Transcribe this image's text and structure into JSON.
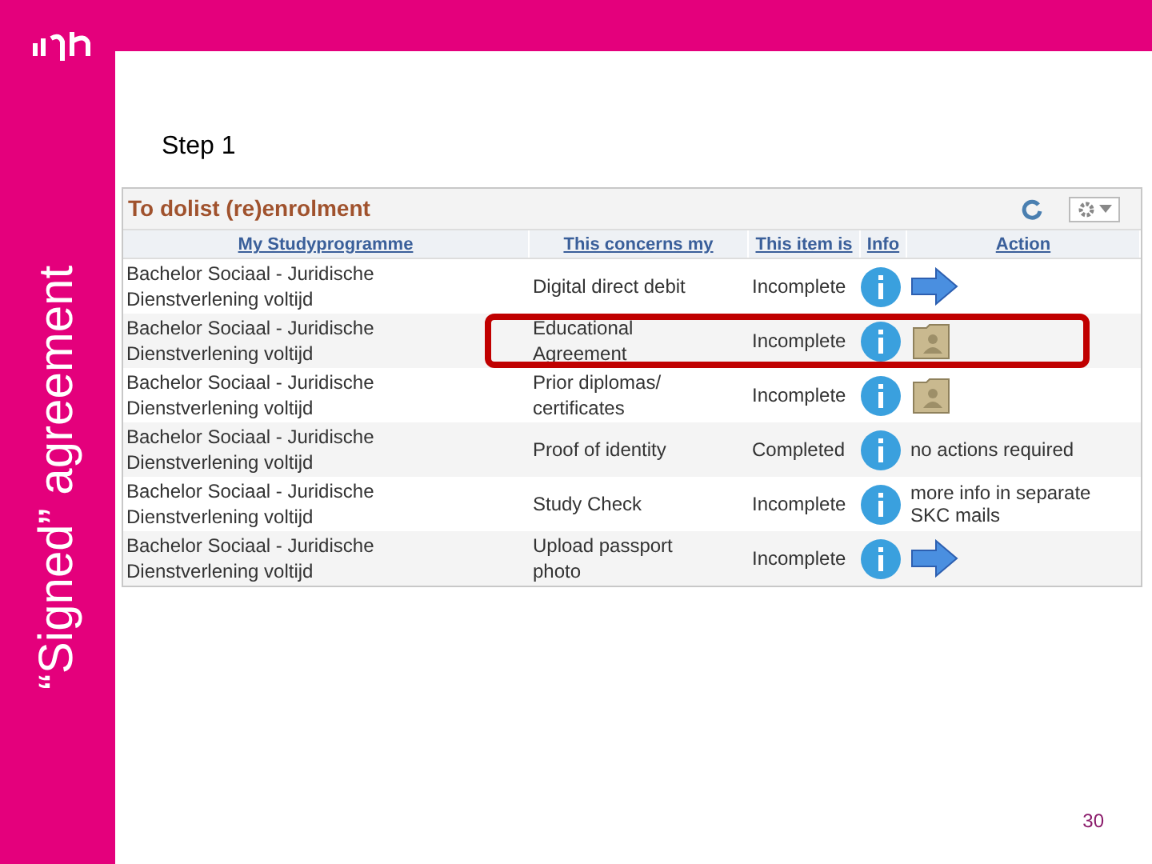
{
  "slide": {
    "side_title": "“Signed” agreement",
    "step": "Step 1",
    "page_number": "30"
  },
  "panel": {
    "title": "To dolist (re)enrolment",
    "columns": [
      "My Studyprogramme",
      "This concerns my",
      "This item is",
      "Info",
      "Action"
    ],
    "rows": [
      {
        "programme": [
          "Bachelor Sociaal - Juridische",
          "Dienstverlening voltijd"
        ],
        "concerns": "Digital direct debit",
        "status": "Incomplete",
        "action": {
          "kind": "arrow"
        },
        "highlighted": false
      },
      {
        "programme": [
          "Bachelor Sociaal - Juridische",
          "Dienstverlening voltijd"
        ],
        "concerns": "Educational Agreement",
        "status": "Incomplete",
        "action": {
          "kind": "folder"
        },
        "highlighted": true
      },
      {
        "programme": [
          "Bachelor Sociaal - Juridische",
          "Dienstverlening voltijd"
        ],
        "concerns": "Prior diplomas/ certificates",
        "status": "Incomplete",
        "action": {
          "kind": "folder"
        },
        "highlighted": false
      },
      {
        "programme": [
          "Bachelor Sociaal - Juridische",
          "Dienstverlening voltijd"
        ],
        "concerns": "Proof of identity",
        "status": "Completed",
        "action": {
          "kind": "text",
          "text": "no actions required"
        },
        "highlighted": false
      },
      {
        "programme": [
          "Bachelor Sociaal - Juridische",
          "Dienstverlening voltijd"
        ],
        "concerns": "Study Check",
        "status": "Incomplete",
        "action": {
          "kind": "text",
          "text": "more info in separate SKC mails"
        },
        "highlighted": false
      },
      {
        "programme": [
          "Bachelor Sociaal - Juridische",
          "Dienstverlening voltijd"
        ],
        "concerns": "Upload passport photo",
        "status": "Incomplete",
        "action": {
          "kind": "arrow"
        },
        "highlighted": false
      }
    ]
  }
}
